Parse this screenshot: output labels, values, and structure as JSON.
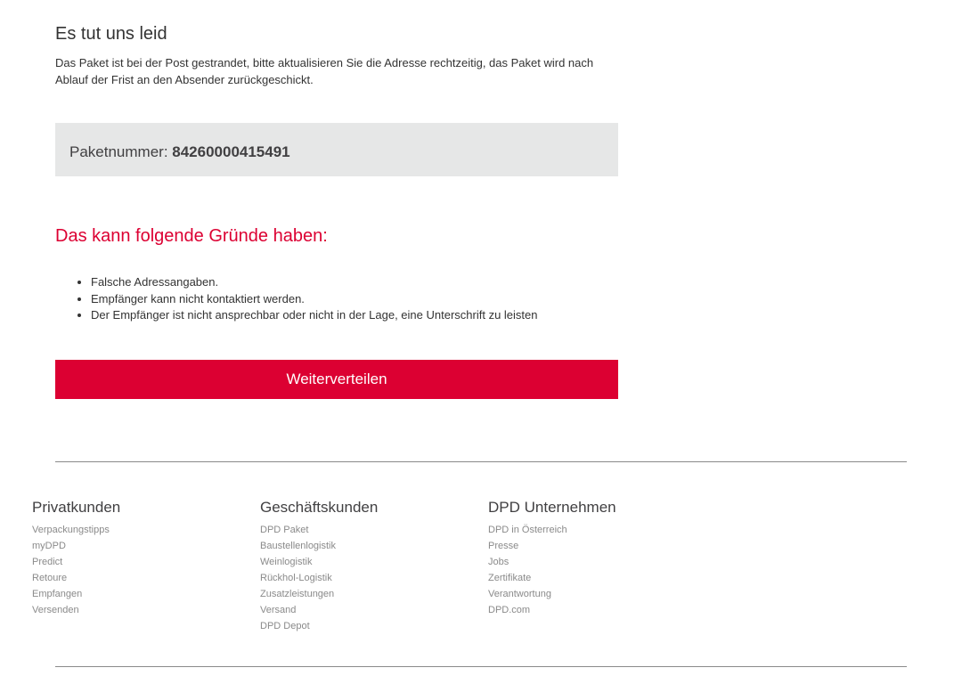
{
  "main": {
    "title": "Es tut uns leid",
    "intro": "Das Paket ist bei der Post gestrandet, bitte aktualisieren Sie die Adresse rechtzeitig, das Paket wird nach Ablauf der Frist an den Absender zurückgeschickt.",
    "parcel": {
      "label": "Paketnummer: ",
      "number": "84260000415491"
    },
    "reasons_title": "Das kann folgende Gründe haben:",
    "reasons": [
      "Falsche Adressangaben.",
      "Empfänger kann nicht kontaktiert werden.",
      "Der Empfänger ist nicht ansprechbar oder nicht in der Lage, eine Unterschrift zu leisten"
    ],
    "cta_label": "Weiterverteilen"
  },
  "footer": {
    "columns": [
      {
        "heading": "Privatkunden",
        "links": [
          "Verpackungstipps",
          "myDPD",
          "Predict",
          "Retoure",
          "Empfangen",
          "Versenden"
        ]
      },
      {
        "heading": "Geschäftskunden",
        "links": [
          "DPD Paket",
          "Baustellenlogistik",
          "Weinlogistik",
          "Rückhol-Logistik",
          "Zusatzleistungen",
          "Versand",
          "DPD Depot"
        ]
      },
      {
        "heading": "DPD Unternehmen",
        "links": [
          "DPD in Österreich",
          "Presse",
          "Jobs",
          "Zertifikate",
          "Verantwortung",
          "DPD.com"
        ]
      }
    ]
  },
  "colors": {
    "accent": "#dc0032",
    "panel": "#e6e7e7",
    "text": "#333333",
    "muted": "#8a8a8a"
  }
}
